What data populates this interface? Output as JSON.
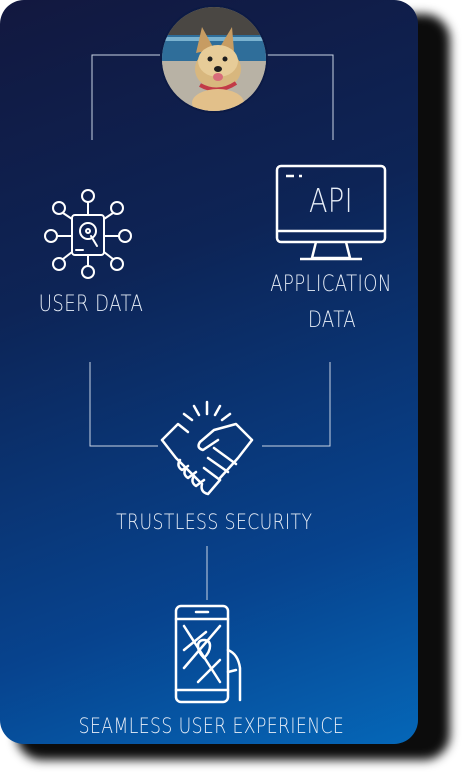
{
  "nodes": {
    "user_data": "USER DATA",
    "application_data_line1": "APPLICATION",
    "application_data_line2": "DATA",
    "api": "API",
    "trustless_security": "TRUSTLESS SECURITY",
    "seamless_ux": "SEAMLESS USER EXPERIENCE"
  },
  "icons": [
    "dog-avatar",
    "hard-drive-network-icon",
    "api-monitor-icon",
    "handshake-icon",
    "smartphone-map-icon"
  ],
  "colors": {
    "gradient_top": "#12183f",
    "gradient_bottom": "#0567b8",
    "line": "#c9d4e4",
    "text": "#e6edf7"
  }
}
